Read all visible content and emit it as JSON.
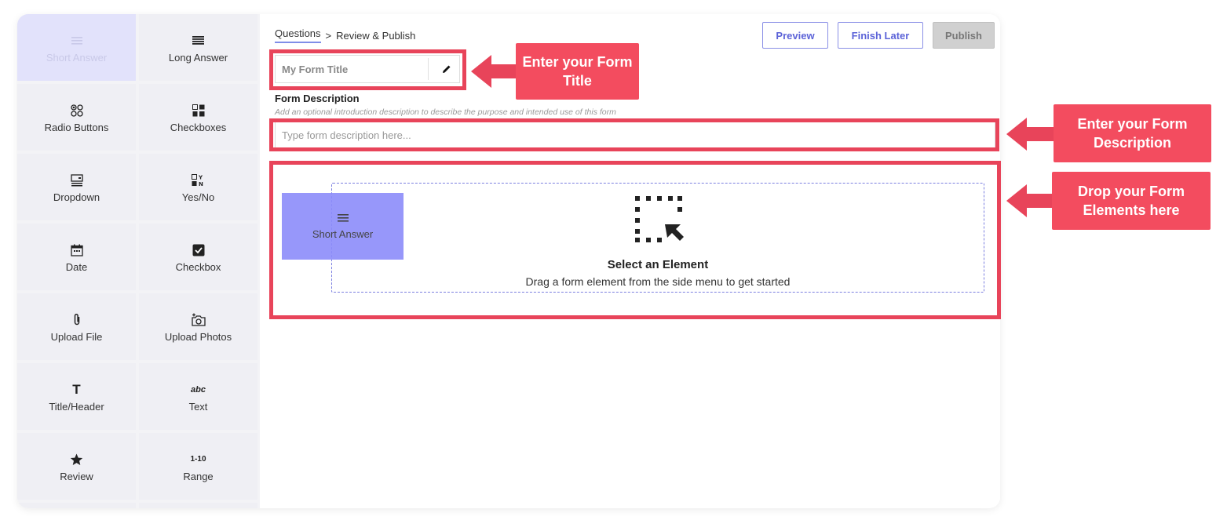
{
  "breadcrumb": {
    "step1": "Questions",
    "separator": ">",
    "step2": "Review & Publish"
  },
  "toolbar": {
    "preview": "Preview",
    "finish_later": "Finish Later",
    "publish": "Publish"
  },
  "sidebar": {
    "items": [
      {
        "label": "Short Answer",
        "icon": "lines-icon"
      },
      {
        "label": "Long Answer",
        "icon": "lines-icon"
      },
      {
        "label": "Radio Buttons",
        "icon": "radio-icon"
      },
      {
        "label": "Checkboxes",
        "icon": "checkboxes-icon"
      },
      {
        "label": "Dropdown",
        "icon": "dropdown-icon"
      },
      {
        "label": "Yes/No",
        "icon": "yes-no-icon"
      },
      {
        "label": "Date",
        "icon": "calendar-icon"
      },
      {
        "label": "Checkbox",
        "icon": "checkbox-icon"
      },
      {
        "label": "Upload File",
        "icon": "paperclip-icon"
      },
      {
        "label": "Upload Photos",
        "icon": "camera-icon"
      },
      {
        "label": "Title/Header",
        "icon": "title-icon"
      },
      {
        "label": "Text",
        "icon": "text-icon"
      },
      {
        "label": "Review",
        "icon": "star-icon"
      },
      {
        "label": "Range",
        "icon": "range-icon"
      }
    ],
    "text_glyph": "abc",
    "range_glyph": "1-10",
    "title_glyph": "T"
  },
  "form": {
    "title_placeholder": "My Form Title",
    "description_label": "Form Description",
    "description_hint": "Add an optional introduction description to describe the purpose and intended use of this form",
    "description_placeholder": "Type form description here..."
  },
  "drop_zone": {
    "title": "Select an Element",
    "subtitle": "Drag a form element from the side menu to get started",
    "dragged_item": "Short Answer"
  },
  "annotations": {
    "title_callout": "Enter your Form Title",
    "description_callout": "Enter your Form Description",
    "elements_callout": "Drop your Form Elements here"
  },
  "colors": {
    "accent": "#5c63d8",
    "highlight": "#e8445a",
    "callout": "#f34c5f",
    "drag_ghost": "#8c8cfa",
    "active_tile": "#e2e2fb"
  }
}
